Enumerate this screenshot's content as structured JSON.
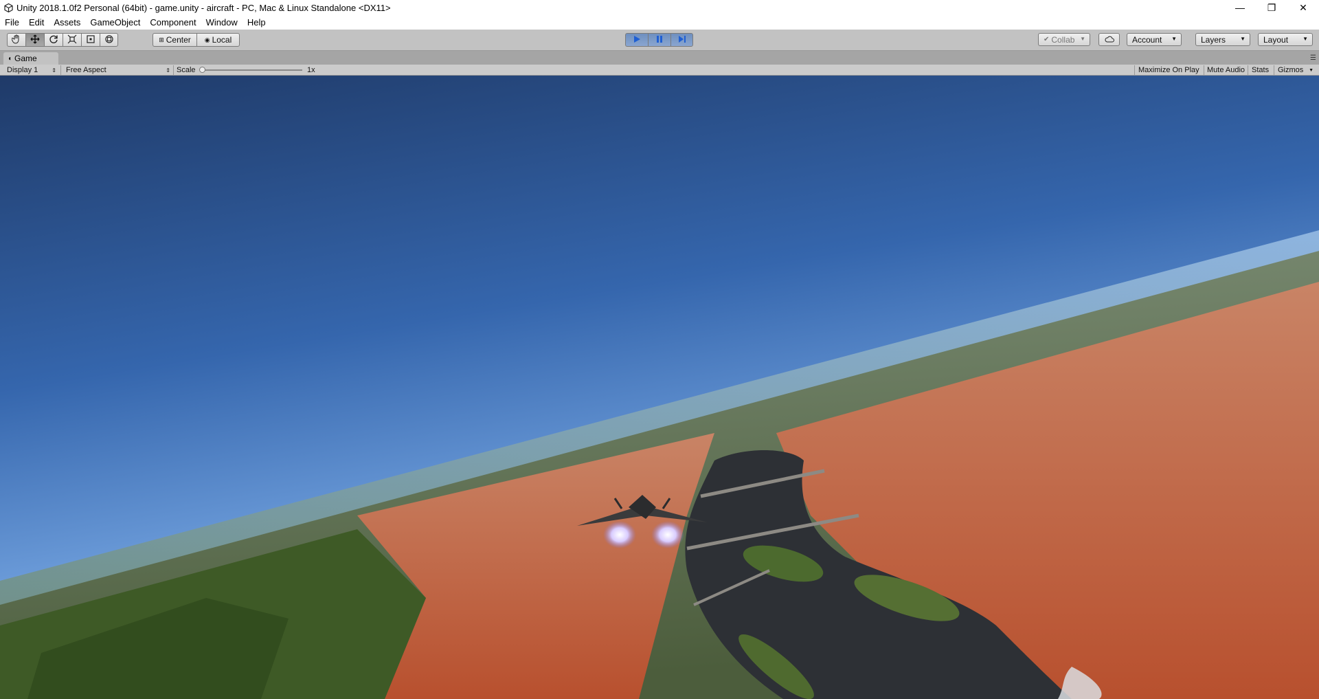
{
  "window": {
    "title": "Unity 2018.1.0f2 Personal (64bit) - game.unity - aircraft - PC, Mac & Linux Standalone <DX11>",
    "minimize_glyph": "—",
    "restore_glyph": "❐",
    "close_glyph": "✕"
  },
  "menu": {
    "items": [
      {
        "label": "File"
      },
      {
        "label": "Edit"
      },
      {
        "label": "Assets"
      },
      {
        "label": "GameObject"
      },
      {
        "label": "Component"
      },
      {
        "label": "Window"
      },
      {
        "label": "Help"
      }
    ]
  },
  "toolbar": {
    "tools": [
      "hand-tool",
      "move-tool",
      "rotate-tool",
      "scale-tool",
      "rect-tool",
      "transform-tool"
    ],
    "pivot_label": "Center",
    "space_label": "Local",
    "play_state": "playing",
    "collab_label": "Collab",
    "account_label": "Account",
    "layers_label": "Layers",
    "layout_label": "Layout"
  },
  "game_tab": {
    "label": "Game",
    "display_label": "Display 1",
    "aspect_label": "Free Aspect",
    "scale_label": "Scale",
    "scale_value": "1x",
    "maximize_label": "Maximize On Play",
    "mute_label": "Mute Audio",
    "stats_label": "Stats",
    "gizmos_label": "Gizmos"
  },
  "colors": {
    "accent_play": "#4b7bc4",
    "sky_top": "#22406f",
    "sky_horizon": "#9cc4ef",
    "roofs": "#c8603c",
    "river": "#2e3136",
    "forest": "#3b5a24"
  }
}
